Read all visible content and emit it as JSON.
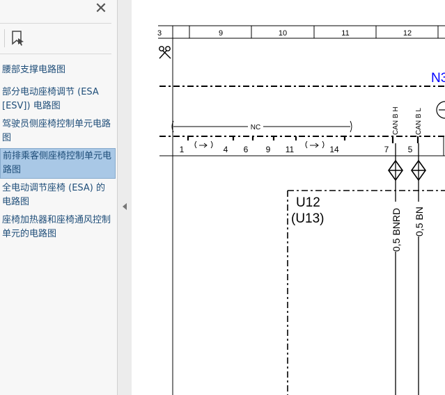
{
  "sidebar": {
    "close_icon": "close-icon",
    "bookmark_icon": "bookmark-icon",
    "items": [
      {
        "label": "腰部支撑电路图"
      },
      {
        "label": "部分电动座椅调节 (ESA [ESV]) 电路图"
      },
      {
        "label": "驾驶员侧座椅控制单元电路图"
      },
      {
        "label": "前排乘客侧座椅控制单元电路图",
        "selected": true
      },
      {
        "label": "全电动调节座椅 (ESA) 的电路图"
      },
      {
        "label": "座椅加热器和座椅通风控制单元的电路图"
      }
    ]
  },
  "diagram": {
    "grid_numbers": [
      "3",
      "9",
      "10",
      "11",
      "12"
    ],
    "nc_label": "NC",
    "pins": [
      "1",
      "4",
      "6",
      "9",
      "11",
      "14",
      "7",
      "5"
    ],
    "can_labels": [
      "CAN B H",
      "CAN B L"
    ],
    "component_label": "U12",
    "component_alt_label": "(U13)",
    "wire_labels": [
      "0,5 BNRD",
      "0,5 BN"
    ],
    "right_label": "N3",
    "colors": {
      "ink": "#000000",
      "blue_label": "#0000ff",
      "selection": "#a9c8e6",
      "link": "#1f4e79"
    }
  }
}
